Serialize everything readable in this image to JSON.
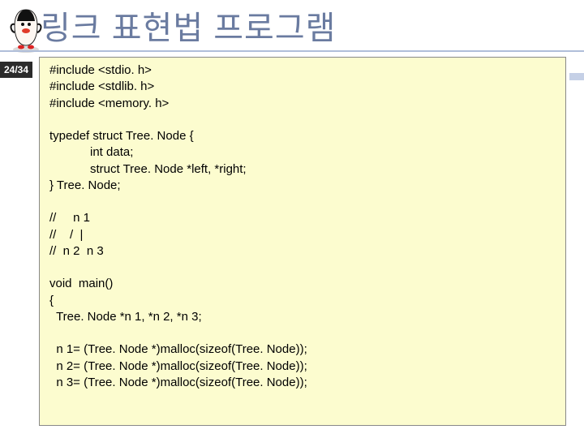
{
  "slide": {
    "title": "링크 표현법 프로그램",
    "page_badge": "24/34"
  },
  "code": {
    "lines": [
      "#include <stdio. h>",
      "#include <stdlib. h>",
      "#include <memory. h>",
      "",
      "typedef struct Tree. Node {",
      "            int data;",
      "            struct Tree. Node *left, *right;",
      "} Tree. Node;",
      "",
      "//     n 1",
      "//    /  |",
      "//  n 2  n 3",
      "",
      "void  main()",
      "{",
      "  Tree. Node *n 1, *n 2, *n 3;",
      "",
      "  n 1= (Tree. Node *)malloc(sizeof(Tree. Node));",
      "  n 2= (Tree. Node *)malloc(sizeof(Tree. Node));",
      "  n 3= (Tree. Node *)malloc(sizeof(Tree. Node));"
    ]
  }
}
